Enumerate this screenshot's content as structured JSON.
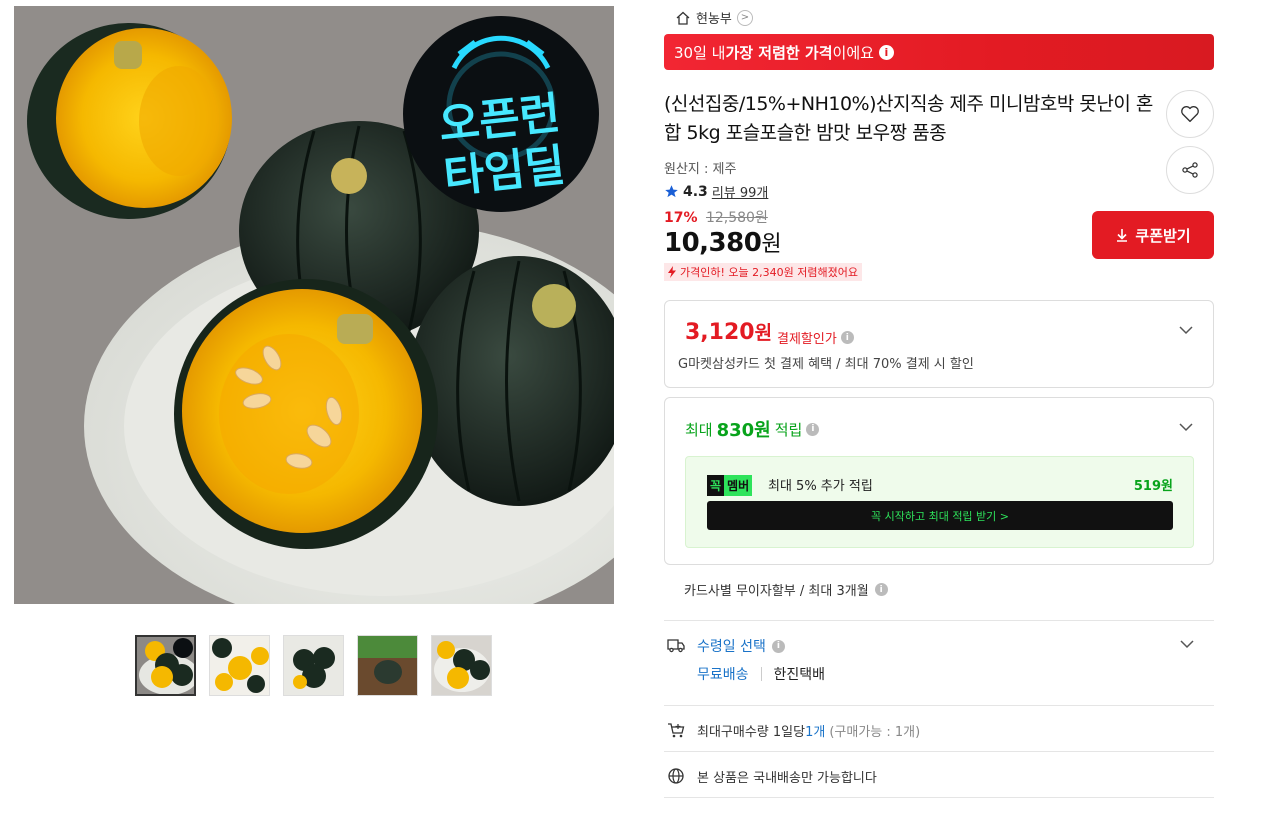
{
  "images": {
    "main_badge_line1": "오픈런",
    "main_badge_line2": "타임딜",
    "thumbnails": [
      "thumb-1",
      "thumb-2",
      "thumb-3",
      "thumb-4",
      "thumb-5"
    ]
  },
  "store": {
    "name": "현농부",
    "go_symbol": ">"
  },
  "banner": {
    "prefix": "30일 내 ",
    "highlight": "가장 저렴한 가격",
    "suffix": "이에요",
    "info_symbol": "i"
  },
  "product": {
    "title": "(신선집중/15%+NH10%)산지직송 제주 미니밤호박 못난이 혼합 5kg 포슬포슬한 밤맛 보우짱 품종",
    "origin": "원산지 : 제주",
    "rating": "4.3",
    "reviews": "리뷰 99개",
    "discount_rate": "17%",
    "original_price": "12,580원",
    "price_number": "10,380",
    "price_unit": "원",
    "price_drop_note": "가격인하! 오늘 2,340원 저렴해졌어요"
  },
  "coupon": {
    "label": "쿠폰받기"
  },
  "payment_discount": {
    "amount_number": "3,120",
    "amount_unit": "원",
    "label": "결제할인가",
    "description": "G마켓삼성카드 첫 결제 혜택 / 최대 70% 결제 시 할인"
  },
  "points": {
    "prefix": "최대 ",
    "amount": "830원",
    "suffix": " 적립",
    "member_badge_1": "꼭",
    "member_badge_2": "멤버",
    "member_text": "최대 5% 추가 적립",
    "member_amount": "519원",
    "member_button": "꼭 시작하고 최대 적립 받기 >"
  },
  "installment": {
    "text": "카드사별 무이자할부 / 최대 3개월"
  },
  "shipping": {
    "label": "수령일 선택",
    "free": "무료배송",
    "carrier": "한진택배"
  },
  "purchase_limit": {
    "prefix": "최대구매수량 1일당 ",
    "count": "1개",
    "note": "(구매가능 : 1개)"
  },
  "domestic": {
    "text": "본 상품은 국내배송만 가능합니다"
  },
  "colors": {
    "accent_red": "#e31b23",
    "green": "#08a31b",
    "blue": "#1a73c8"
  }
}
